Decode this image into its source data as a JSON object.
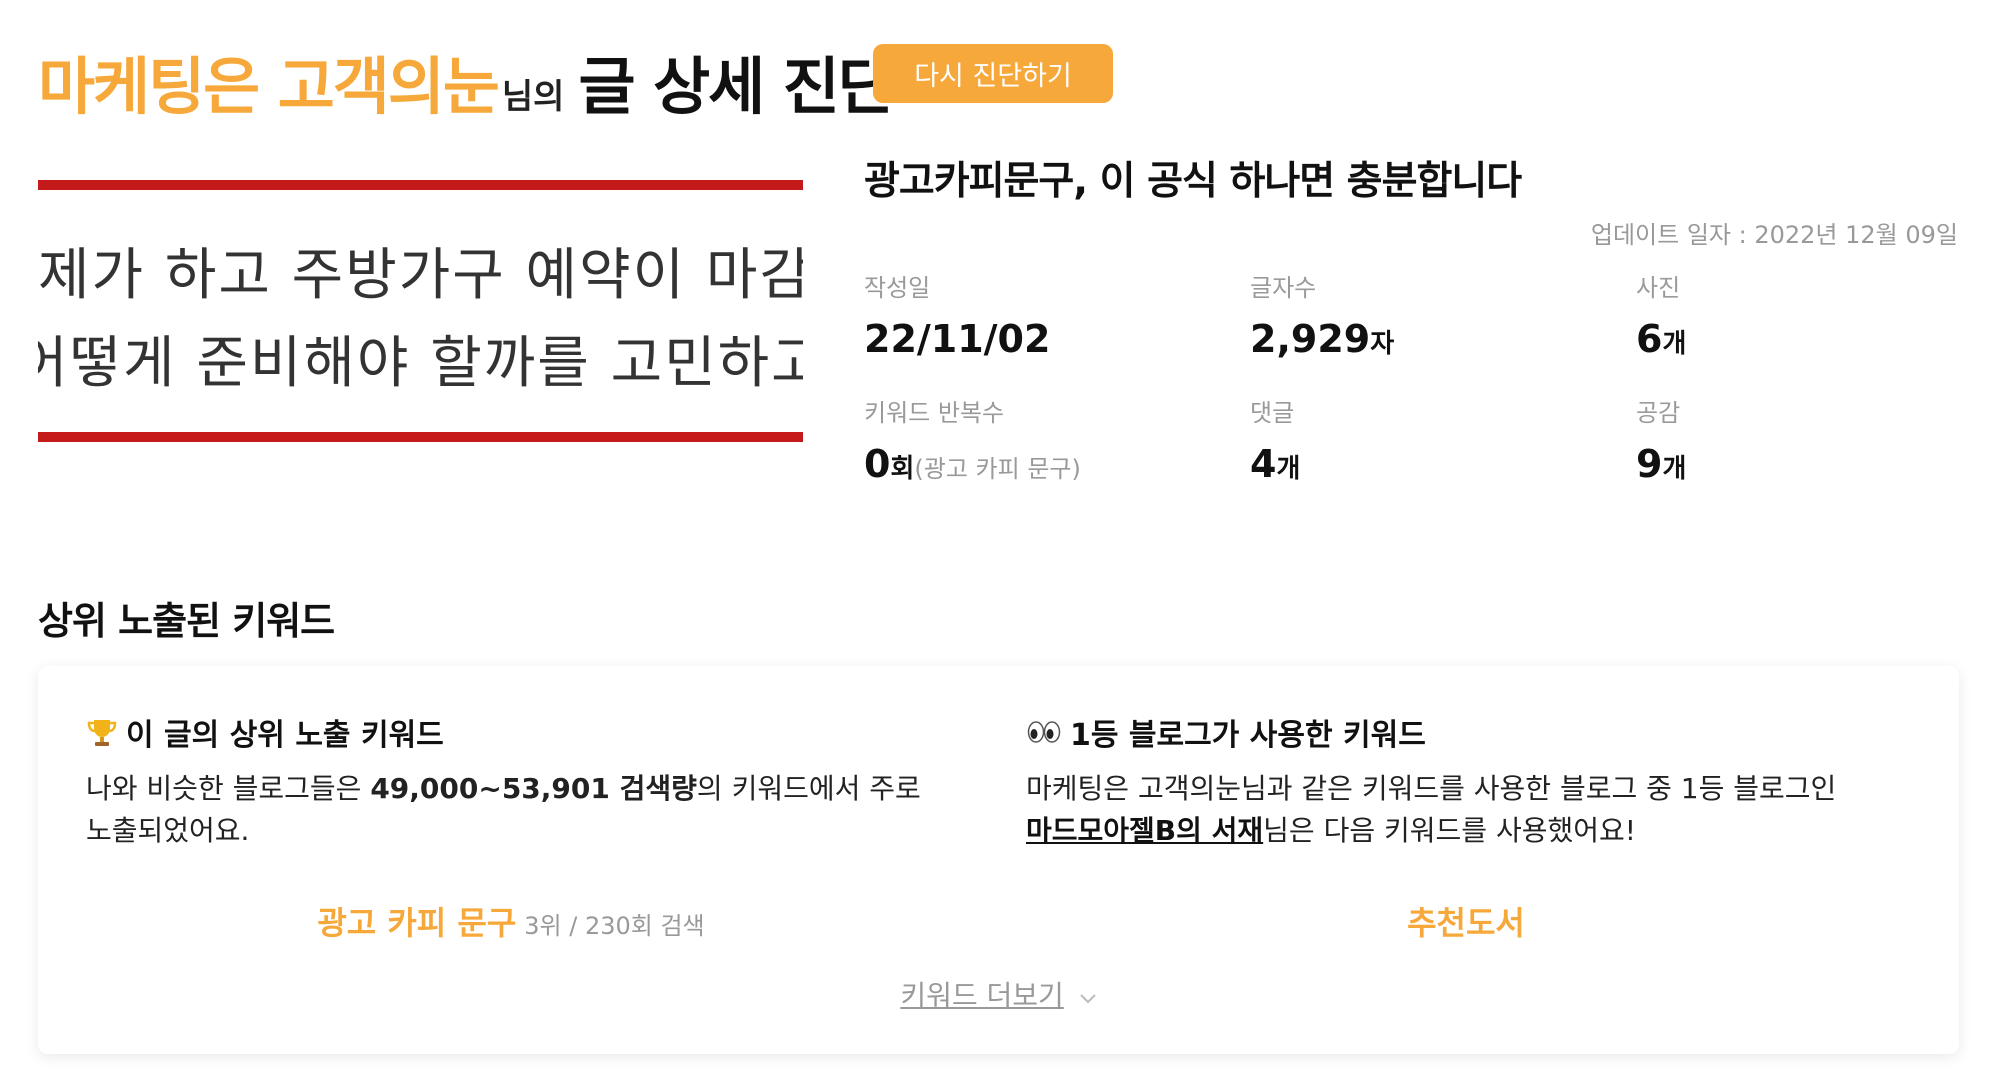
{
  "header": {
    "blog_name": "마케팅은 고객의눈",
    "name_suffix": "님의",
    "title": "글 상세 진단",
    "rediagnose_label": "다시 진단하기"
  },
  "thumbnail": {
    "line1": "제가 하고 주방가구 예약이 마감이 .",
    "line2": "어떻게 준비해야 할까를 고민하고 있"
  },
  "post": {
    "title": "광고카피문구, 이 공식 하나면 충분합니다",
    "update_text": "업데이트 일자 : 2022년 12월 09일",
    "stats": {
      "date": {
        "label": "작성일",
        "value": "22/11/02"
      },
      "chars": {
        "label": "글자수",
        "value": "2,929",
        "unit": "자"
      },
      "photos": {
        "label": "사진",
        "value": "6",
        "unit": "개"
      },
      "keyword_repeat": {
        "label": "키워드 반복수",
        "value": "0",
        "unit": "회",
        "keyword": "(광고 카피 문구)"
      },
      "comments": {
        "label": "댓글",
        "value": "4",
        "unit": "개"
      },
      "likes": {
        "label": "공감",
        "value": "9",
        "unit": "개"
      }
    }
  },
  "section": {
    "title": "상위 노출된 키워드"
  },
  "left": {
    "icon": "trophy-icon",
    "title": "이 글의 상위 노출 키워드",
    "desc_pre": "나와 비슷한 블로그들은 ",
    "desc_bold": "49,000~53,901 검색량",
    "desc_post": "의 키워드에서 주로 노출되었어요.",
    "keyword": "광고 카피 문구",
    "keyword_meta": "3위 / 230회 검색"
  },
  "right": {
    "icon": "eyes-icon",
    "title": "1등 블로그가 사용한 키워드",
    "desc_line1": "마케팅은 고객의눈님과 같은 키워드를 사용한 블로그 중 1등 블로그인",
    "blog_link": "마드모아젤B의 서재",
    "desc_line2_post": "님은 다음 키워드를 사용했어요!",
    "keyword": "추천도서"
  },
  "more": {
    "label": "키워드 더보기",
    "icon": "chevron-down-icon"
  },
  "colors": {
    "accent": "#f7a83a",
    "thumb_bar": "#c41a1a"
  }
}
